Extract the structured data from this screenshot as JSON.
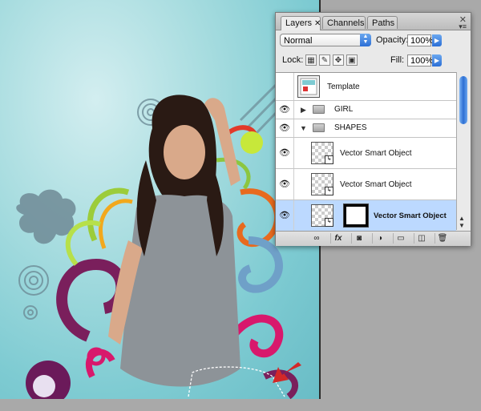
{
  "panel": {
    "tabs": [
      {
        "label": "Layers",
        "active": true,
        "close": "✕"
      },
      {
        "label": "Channels",
        "active": false
      },
      {
        "label": "Paths",
        "active": false
      }
    ],
    "close_glyph": "✕",
    "menu_glyph": "▾≡",
    "blend_mode": "Normal",
    "opacity_label": "Opacity:",
    "opacity_value": "100%",
    "lock_label": "Lock:",
    "fill_label": "Fill:",
    "fill_value": "100%",
    "layers": [
      {
        "name": "Template",
        "visible": false,
        "type": "layer"
      },
      {
        "name": "GIRL",
        "visible": true,
        "type": "group",
        "expanded": false
      },
      {
        "name": "SHAPES",
        "visible": true,
        "type": "group",
        "expanded": true
      },
      {
        "name": "Vector Smart Object",
        "visible": true,
        "type": "smart-object"
      },
      {
        "name": "Vector Smart Object",
        "visible": true,
        "type": "smart-object"
      },
      {
        "name": "Vector Smart Object",
        "visible": true,
        "type": "smart-object-with-mask",
        "selected": true
      }
    ],
    "bottom_buttons": [
      "link-icon",
      "fx-icon",
      "mask-icon",
      "adjustment-icon",
      "folder-icon",
      "new-layer-icon",
      "trash-icon"
    ],
    "bottom_glyphs": {
      "link": "∞",
      "fx": "fx",
      "mask": "◙",
      "adjust": "◑",
      "folder": "▭",
      "new": "◫",
      "trash": "🗑"
    }
  },
  "colors": {
    "selection": "#bcd9ff",
    "accent_blue": "#2c6fd6",
    "canvas_teal": "#7ecbd2",
    "arrow_red": "#d32828"
  },
  "glyphs": {
    "eye": "👁",
    "tri_right": "▶",
    "tri_down": "▼",
    "up": "▲",
    "down": "▼",
    "spin": "⬍",
    "arrow": "▶"
  }
}
